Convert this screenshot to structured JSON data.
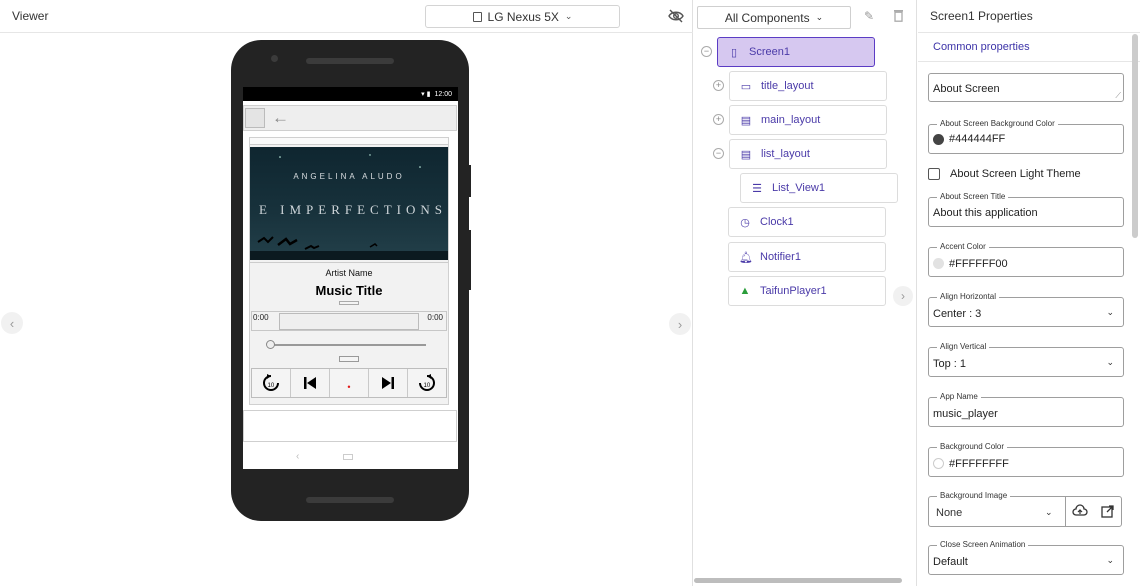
{
  "viewer": {
    "title": "Viewer",
    "device": "LG Nexus 5X",
    "chevron": "⌄"
  },
  "phone": {
    "status_time": "12:00",
    "app": {
      "album_artist": "ANGELINA ALUDO",
      "album_title": "E IMPERFECTIONS",
      "artist_name": "Artist Name",
      "music_title": "Music Title",
      "time_start": "0:00",
      "time_end": "0:00",
      "controls": [
        {
          "name": "replay-10-icon",
          "glyph": "↺"
        },
        {
          "name": "skip-previous-icon",
          "glyph": "⏮"
        },
        {
          "name": "play-icon",
          "glyph": "•"
        },
        {
          "name": "skip-next-icon",
          "glyph": "⏭"
        },
        {
          "name": "forward-10-icon",
          "glyph": "↻"
        }
      ]
    }
  },
  "components": {
    "dropdown_label": "All Components",
    "tree": [
      {
        "label": "Screen1",
        "icon": "phone-icon"
      },
      {
        "label": "title_layout",
        "icon": "horizontal-layout-icon"
      },
      {
        "label": "main_layout",
        "icon": "vertical-layout-icon"
      },
      {
        "label": "list_layout",
        "icon": "vertical-layout-icon"
      },
      {
        "label": "List_View1",
        "icon": "listview-icon"
      },
      {
        "label": "Clock1",
        "icon": "clock-icon"
      },
      {
        "label": "Notifier1",
        "icon": "bell-icon"
      },
      {
        "label": "TaifunPlayer1",
        "icon": "player-extension-icon"
      }
    ]
  },
  "properties": {
    "title": "Screen1 Properties",
    "tab": "Common properties",
    "about_screen": "About Screen",
    "about_bg_color_label": "About Screen Background Color",
    "about_bg_color_value": "#444444FF",
    "about_light_theme_label": "About Screen Light Theme",
    "about_title_label": "About Screen Title",
    "about_title_value": "About this application",
    "accent_label": "Accent Color",
    "accent_value": "#FFFFFF00",
    "align_h_label": "Align Horizontal",
    "align_h_value": "Center : 3",
    "align_v_label": "Align Vertical",
    "align_v_value": "Top : 1",
    "app_name_label": "App Name",
    "app_name_value": "music_player",
    "bg_color_label": "Background Color",
    "bg_color_value": "#FFFFFFFF",
    "bg_image_label": "Background Image",
    "bg_image_value": "None",
    "close_anim_label": "Close Screen Animation",
    "close_anim_value": "Default"
  },
  "colors": {
    "accent": "#5b3cc4",
    "selected_bg": "#d6c8f0",
    "swatch_dark": "#444444"
  }
}
